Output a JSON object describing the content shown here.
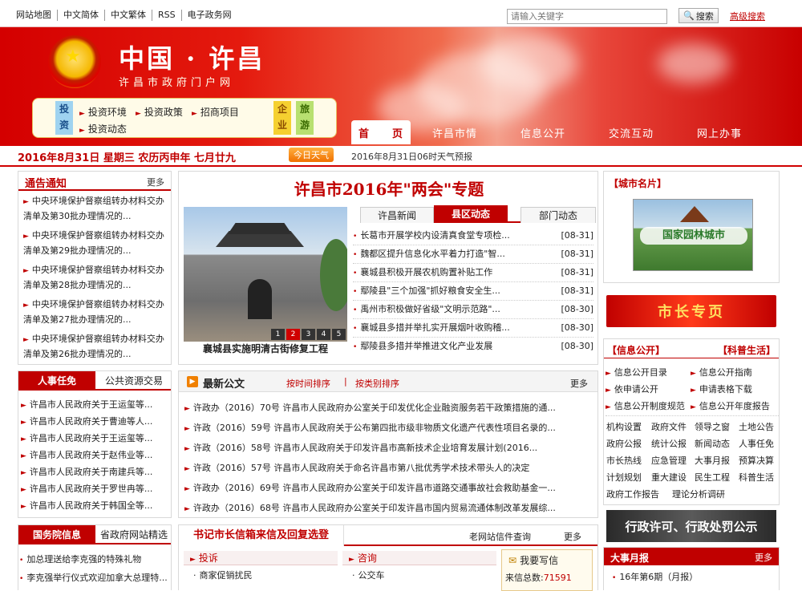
{
  "top": {
    "links": [
      "网站地图",
      "中文简体",
      "中文繁体",
      "RSS",
      "电子政务网"
    ],
    "search_placeholder": "请输入关键字",
    "search_label": "搜索",
    "advanced_search": "高级搜索"
  },
  "banner": {
    "title": "中国 · 许昌",
    "subtitle": "许昌市政府门户网",
    "invest_label": "投资",
    "invest_links": [
      "投资环境",
      "投资政策",
      "招商项目",
      "投资动态"
    ],
    "enterprise_label": "企业",
    "tourism_label": "旅游"
  },
  "nav": [
    "首　　页",
    "许昌市情",
    "信息公开",
    "交流互动",
    "网上办事"
  ],
  "datebar": {
    "date": "2016年8月31日 星期三 农历丙申年 七月廿九",
    "weather_button": "今日天气",
    "weather_text": "2016年8月31日06时天气预报"
  },
  "notice": {
    "title": "通告通知",
    "more": "更多",
    "items": [
      "中央环境保护督察组转办材料交办清单及第30批办理情况的...",
      "中央环境保护督察组转办材料交办清单及第29批办理情况的...",
      "中央环境保护督察组转办材料交办清单及第28批办理情况的...",
      "中央环境保护督察组转办材料交办清单及第27批办理情况的...",
      "中央环境保护督察组转办材料交办清单及第26批办理情况的..."
    ]
  },
  "special": {
    "title": "许昌市2016年\"两会\"专题",
    "photo_caption": "襄城县实施明清古街修复工程",
    "pager": [
      "1",
      "2",
      "3",
      "4",
      "5"
    ],
    "tabs": [
      "许昌新闻",
      "县区动态",
      "部门动态"
    ],
    "news": [
      {
        "title": "长葛市开展学校内设清真食堂专项检...",
        "date": "[08-31]"
      },
      {
        "title": "魏都区提升信息化水平着力打造\"智...",
        "date": "[08-31]"
      },
      {
        "title": "襄城县积极开展农机购置补贴工作",
        "date": "[08-31]"
      },
      {
        "title": "鄢陵县\"三个加强\"抓好粮食安全生...",
        "date": "[08-31]"
      },
      {
        "title": "禹州市积极做好省级\"文明示范路\"...",
        "date": "[08-30]"
      },
      {
        "title": "襄城县多措并举扎实开展烟叶收购稽...",
        "date": "[08-30]"
      },
      {
        "title": "鄢陵县多措并举推进文化产业发展",
        "date": "[08-30]"
      }
    ]
  },
  "city_card": {
    "title": "【城市名片】",
    "image_text": "国家园林城市",
    "mayor_banner": "市长专页"
  },
  "personnel": {
    "tab_active": "人事任免",
    "tab_other": "公共资源交易",
    "items": [
      "许昌市人民政府关于王运玺等...",
      "许昌市人民政府关于曹迪等人...",
      "许昌市人民政府关于王运玺等...",
      "许昌市人民政府关于赵伟业等...",
      "许昌市人民政府关于南建兵等...",
      "许昌市人民政府关于罗世冉等...",
      "许昌市人民政府关于韩国全等..."
    ]
  },
  "docs": {
    "title": "最新公文",
    "sort_time": "按时间排序",
    "sort_category": "按类别排序",
    "more": "更多",
    "items": [
      "许政办（2016）70号  许昌市人民政府办公室关于印发优化企业融资服务若干政策措施的通...",
      "许政（2016）59号  许昌市人民政府关于公布第四批市级非物质文化遗产代表性项目名录的...",
      "许政（2016）58号  许昌市人民政府关于印发许昌市高新技术企业培育发展计划(2016...",
      "许政（2016）57号  许昌市人民政府关于命名许昌市第八批优秀学术技术带头人的决定",
      "许政办（2016）69号  许昌市人民政府办公室关于印发许昌市道路交通事故社会救助基金一...",
      "许政办（2016）68号  许昌市人民政府办公室关于印发许昌市国内贸易流通体制改革发展综..."
    ]
  },
  "info_open": {
    "title_left": "【信息公开】",
    "title_right": "【科普生活】",
    "links": [
      "信息公开目录",
      "信息公开指南",
      "依申请公开",
      "申请表格下载",
      "信息公开制度规范",
      "信息公开年度报告"
    ],
    "grid": [
      "机构设置",
      "政府文件",
      "领导之窗",
      "土地公告",
      "政府公报",
      "统计公报",
      "新闻动态",
      "人事任免",
      "市长热线",
      "应急管理",
      "大事月报",
      "预算决算",
      "计划规划",
      "重大建设",
      "民生工程",
      "科普生活",
      "政府工作报告",
      "理论分析调研"
    ]
  },
  "permit_banner": "行政许可、行政处罚公示",
  "state_council": {
    "tab_active": "国务院信息",
    "tab_other": "省政府网站精选",
    "items": [
      "加总理送给李克强的特殊礼物",
      "李克强举行仪式欢迎加拿大总理特..."
    ]
  },
  "mailbox": {
    "title": "书记市长信箱来信及回复选登",
    "old_site": "老网站信件查询",
    "more": "更多",
    "complaint": "投诉",
    "consult": "咨询",
    "complaint_item": "商家促销扰民",
    "consult_item": "公交车",
    "write_letter": "我要写信",
    "total_label": "来信总数:",
    "total_value": "71591"
  },
  "monthly": {
    "title": "大事月报",
    "more": "更多",
    "item": "16年第6期（月报）"
  }
}
